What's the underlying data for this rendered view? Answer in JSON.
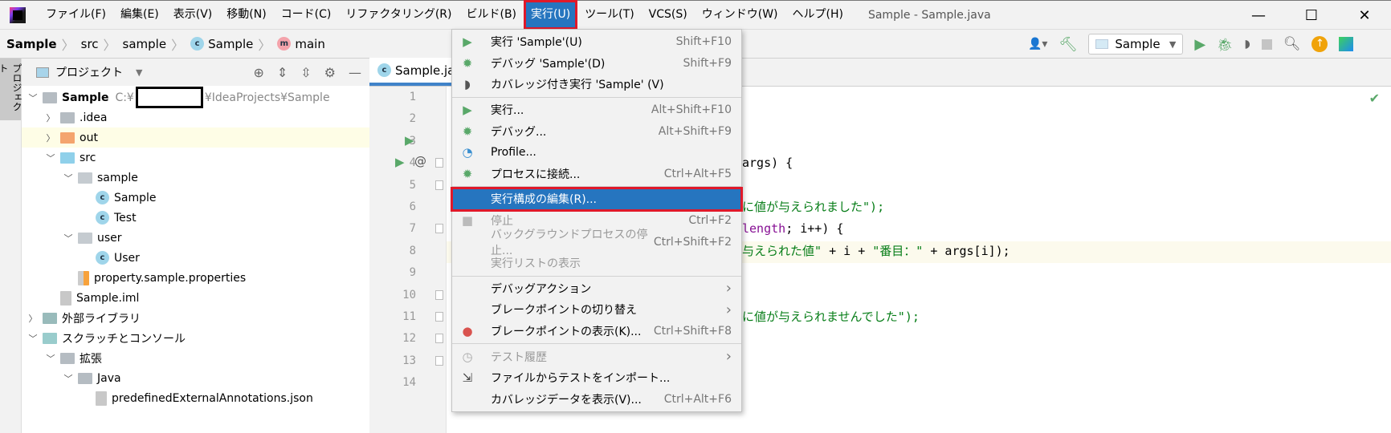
{
  "menubar": {
    "items": [
      "ファイル(F)",
      "編集(E)",
      "表示(V)",
      "移動(N)",
      "コード(C)",
      "リファクタリング(R)",
      "ビルド(B)",
      "実行(U)",
      "ツール(T)",
      "VCS(S)",
      "ウィンドウ(W)",
      "ヘルプ(H)"
    ],
    "active": "実行(U)",
    "title": "Sample - Sample.java"
  },
  "breadcrumb": [
    "Sample",
    "src",
    "sample",
    "Sample",
    "main"
  ],
  "toolbar": {
    "run_config": "Sample"
  },
  "sidebar": {
    "tab": "プロジェクト"
  },
  "project": {
    "title": "プロジェクト",
    "tree": [
      {
        "label": "Sample",
        "path": "C:¥",
        "path2": "¥IdeaProjects¥Sample",
        "level": 0,
        "arrow": "down",
        "icon": "module-folder"
      },
      {
        "label": ".idea",
        "level": 1,
        "arrow": "right",
        "icon": "folder"
      },
      {
        "label": "out",
        "level": 1,
        "arrow": "right",
        "icon": "folder-orange",
        "highlight": true
      },
      {
        "label": "src",
        "level": 1,
        "arrow": "down",
        "icon": "folder-blue"
      },
      {
        "label": "sample",
        "level": 2,
        "arrow": "down",
        "icon": "package"
      },
      {
        "label": "Sample",
        "level": 3,
        "icon": "class-runnable"
      },
      {
        "label": "Test",
        "level": 3,
        "icon": "class"
      },
      {
        "label": "user",
        "level": 2,
        "arrow": "down",
        "icon": "package"
      },
      {
        "label": "User",
        "level": 3,
        "icon": "class"
      },
      {
        "label": "property.sample.properties",
        "level": 2,
        "icon": "properties-file"
      },
      {
        "label": "Sample.iml",
        "level": 1,
        "icon": "iml-file"
      },
      {
        "label": "外部ライブラリ",
        "level": 0,
        "arrow": "right",
        "icon": "library"
      },
      {
        "label": "スクラッチとコンソール",
        "level": 0,
        "arrow": "down",
        "icon": "scratches"
      },
      {
        "label": "拡張",
        "level": 1,
        "arrow": "down",
        "icon": "folder"
      },
      {
        "label": "Java",
        "level": 2,
        "arrow": "down",
        "icon": "folder"
      },
      {
        "label": "predefinedExternalAnnotations.json",
        "level": 3,
        "icon": "json-file"
      }
    ]
  },
  "editor": {
    "tab": "Sample.java",
    "line_numbers": [
      "1",
      "2",
      "3",
      "4",
      "5",
      "6",
      "7",
      "8",
      "9",
      "10",
      "11",
      "12",
      "13",
      "14"
    ],
    "code_fragments": {
      "l4": "args) {",
      "l6": "に値が与えられました\");",
      "l7a": "length",
      "l7b": "; i++) {",
      "l8a": "与えられた値\"",
      "l8b": " + i + ",
      "l8c": "\"番目：\"",
      "l8d": " + args[i]);",
      "l11": "に値が与えられませんでした\");"
    }
  },
  "run_menu": {
    "items": [
      {
        "label": "実行 'Sample'(U)",
        "shortcut": "Shift+F10",
        "icon": "run-icon"
      },
      {
        "label": "デバッグ 'Sample'(D)",
        "shortcut": "Shift+F9",
        "icon": "debug-icon"
      },
      {
        "label": "カバレッジ付き実行  'Sample' (V)",
        "shortcut": "",
        "icon": "coverage-icon"
      },
      {
        "label": "実行...",
        "shortcut": "Alt+Shift+F10",
        "icon": "run-icon"
      },
      {
        "label": "デバッグ...",
        "shortcut": "Alt+Shift+F9",
        "icon": "debug-icon"
      },
      {
        "label": "Profile...",
        "shortcut": "",
        "icon": "profile-icon"
      },
      {
        "label": "プロセスに接続...",
        "shortcut": "Ctrl+Alt+F5",
        "icon": "attach-icon"
      },
      {
        "label": "実行構成の編集(R)...",
        "shortcut": "",
        "selected": true
      },
      {
        "label": "停止",
        "shortcut": "Ctrl+F2",
        "icon": "stop-icon",
        "disabled": true
      },
      {
        "label": "バックグラウンドプロセスの停止...",
        "shortcut": "Ctrl+Shift+F2",
        "disabled": true
      },
      {
        "label": "実行リストの表示",
        "shortcut": "",
        "disabled": true
      },
      {
        "label": "デバッグアクション",
        "submenu": true
      },
      {
        "label": "ブレークポイントの切り替え",
        "submenu": true
      },
      {
        "label": "ブレークポイントの表示(K)...",
        "shortcut": "Ctrl+Shift+F8",
        "icon": "breakpoints-icon"
      },
      {
        "label": "テスト履歴",
        "submenu": true,
        "disabled": true,
        "icon": "history-icon"
      },
      {
        "label": "ファイルからテストをインポート...",
        "icon": "import-icon"
      },
      {
        "label": "カバレッジデータを表示(V)...",
        "shortcut": "Ctrl+Alt+F6"
      }
    ]
  },
  "colors": {
    "accent": "#2675bf",
    "highlight_box": "#e0192a",
    "run_green": "#59a869",
    "string": "#067d17",
    "keyword": "#871094"
  }
}
